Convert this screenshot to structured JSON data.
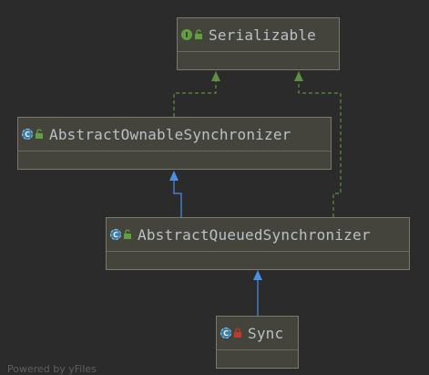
{
  "diagram": {
    "nodes": [
      {
        "id": "serializable",
        "label": "Serializable",
        "kind": "interface",
        "visibility": "public"
      },
      {
        "id": "aos",
        "label": "AbstractOwnableSynchronizer",
        "kind": "abstract-class",
        "visibility": "public"
      },
      {
        "id": "aqs",
        "label": "AbstractQueuedSynchronizer",
        "kind": "abstract-class",
        "visibility": "public"
      },
      {
        "id": "sync",
        "label": "Sync",
        "kind": "abstract-class",
        "visibility": "private"
      }
    ],
    "edges": [
      {
        "from": "aos",
        "to": "serializable",
        "type": "implements",
        "style": "dashed",
        "color": "#5e8f42"
      },
      {
        "from": "aqs",
        "to": "serializable",
        "type": "implements",
        "style": "dashed",
        "color": "#5e8f42"
      },
      {
        "from": "aqs",
        "to": "aos",
        "type": "extends",
        "style": "solid",
        "color": "#4a90e2"
      },
      {
        "from": "sync",
        "to": "aqs",
        "type": "extends",
        "style": "solid",
        "color": "#4a90e2"
      }
    ]
  },
  "footer": {
    "text": "Powered by yFiles"
  },
  "colors": {
    "background": "#2b2b2b",
    "node_fill": "#45443c",
    "node_border": "#7a7a6c",
    "interface_icon": "#62a03f",
    "abstract_icon": "#3a7ca5",
    "extends_arrow": "#4a90e2",
    "implements_arrow": "#5e8f42",
    "private_lock": "#c0392b"
  }
}
